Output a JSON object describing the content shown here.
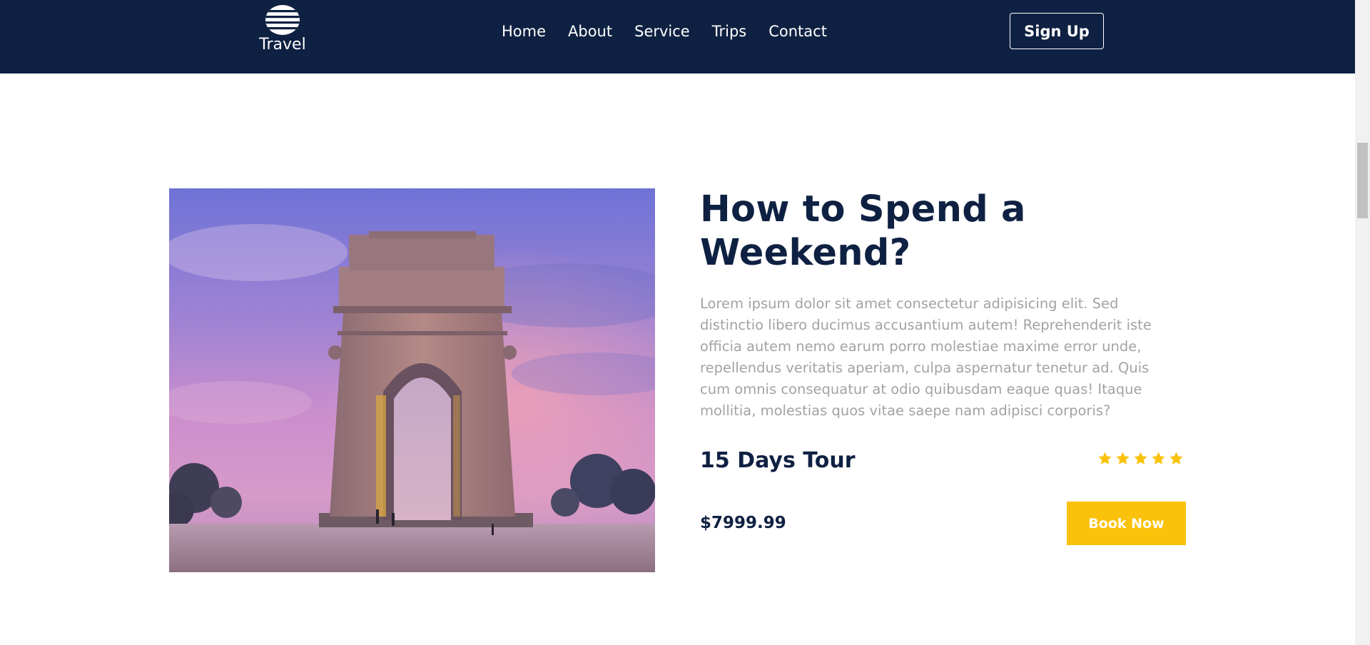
{
  "brand": {
    "name": "Travel",
    "logo_icon": "globe-icon"
  },
  "nav": {
    "items": [
      {
        "label": "Home"
      },
      {
        "label": "About"
      },
      {
        "label": "Service"
      },
      {
        "label": "Trips"
      },
      {
        "label": "Contact"
      }
    ],
    "signup_label": "Sign Up"
  },
  "tour": {
    "image_icon": "india-gate-photo",
    "title": "How to Spend a Weekend?",
    "description": "Lorem ipsum dolor sit amet consectetur adipisicing elit. Sed distinctio libero ducimus accusantium autem! Reprehenderit iste officia autem nemo earum porro molestiae maxime error unde, repellendus veritatis aperiam, culpa aspernatur tenetur ad. Quis cum omnis consequatur at odio quibusdam eaque quas! Itaque mollitia, molestias quos vitae saepe nam adipisci corporis?",
    "duration": "15 Days Tour",
    "rating": 5,
    "rating_max": 5,
    "price": "$7999.99",
    "book_label": "Book Now"
  },
  "colors": {
    "navbar": "#0f2142",
    "heading": "#0f2142",
    "body_text": "#a3a3a3",
    "accent": "#fbc20c",
    "star": "#fbc20c"
  }
}
